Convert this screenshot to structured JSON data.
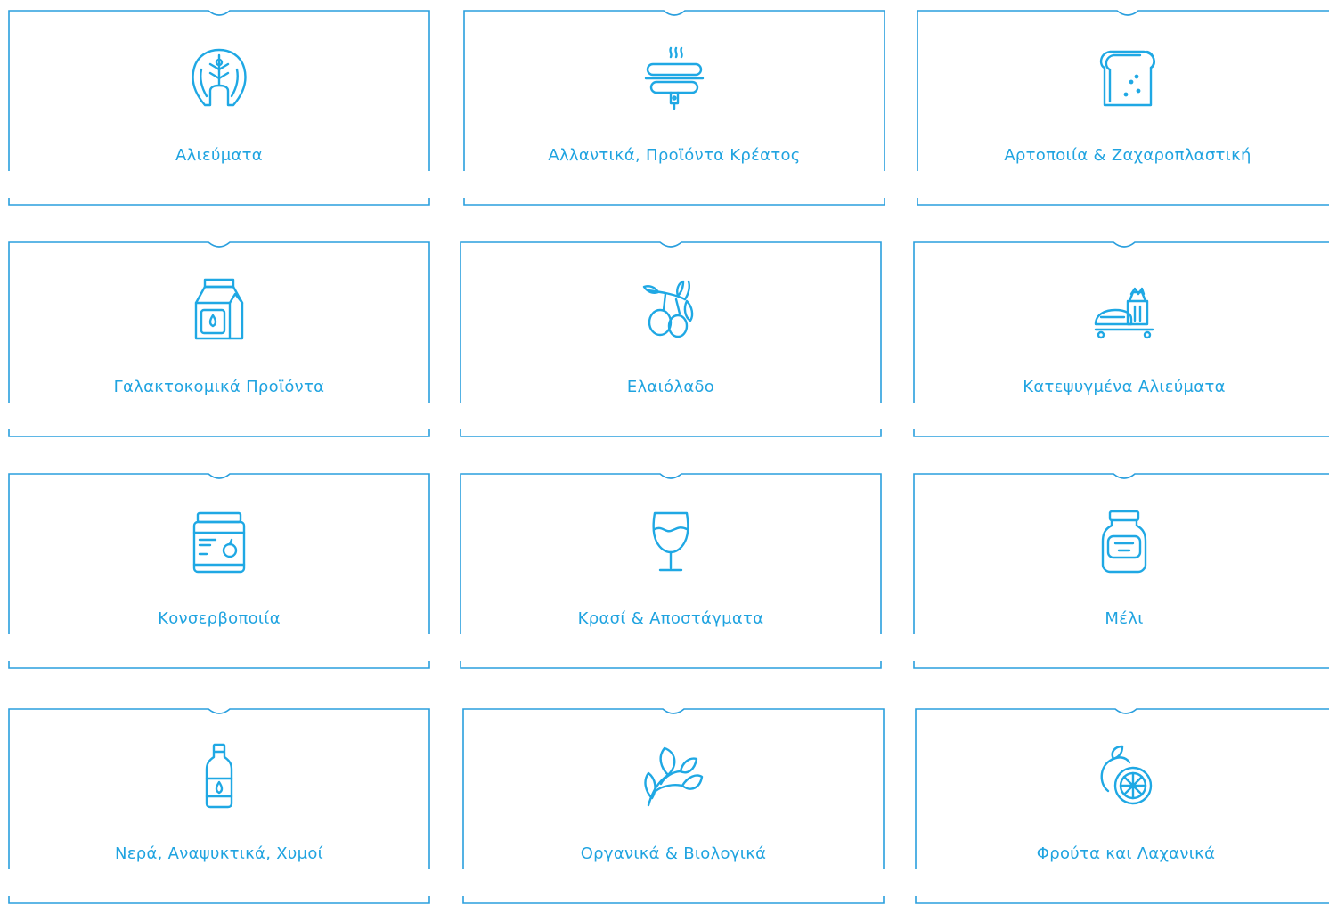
{
  "accent_color": "#1fa8e4",
  "categories": [
    {
      "label": "Αλιεύματα",
      "icon": "fish-steak-icon"
    },
    {
      "label": "Αλλαντικά, Προϊόντα Κρέατος",
      "icon": "sausage-grill-icon"
    },
    {
      "label": "Αρτοποιία & Ζαχαροπλαστική",
      "icon": "bread-slice-icon"
    },
    {
      "label": "Γαλακτοκομικά Προϊόντα",
      "icon": "milk-carton-icon"
    },
    {
      "label": "Ελαιόλαδο",
      "icon": "olive-branch-icon"
    },
    {
      "label": "Κατεψυγμένα Αλιεύματα",
      "icon": "frozen-seafood-icon"
    },
    {
      "label": "Κονσερβοποιία",
      "icon": "canned-food-jar-icon"
    },
    {
      "label": "Κρασί & Αποστάγματα",
      "icon": "wine-glass-icon"
    },
    {
      "label": "Μέλι",
      "icon": "honey-jar-icon"
    },
    {
      "label": "Νερά, Αναψυκτικά, Χυμοί",
      "icon": "water-bottle-icon"
    },
    {
      "label": "Οργανικά & Βιολογικά",
      "icon": "leafy-greens-icon"
    },
    {
      "label": "Φρούτα και Λαχανικά",
      "icon": "citrus-fruit-icon"
    }
  ]
}
